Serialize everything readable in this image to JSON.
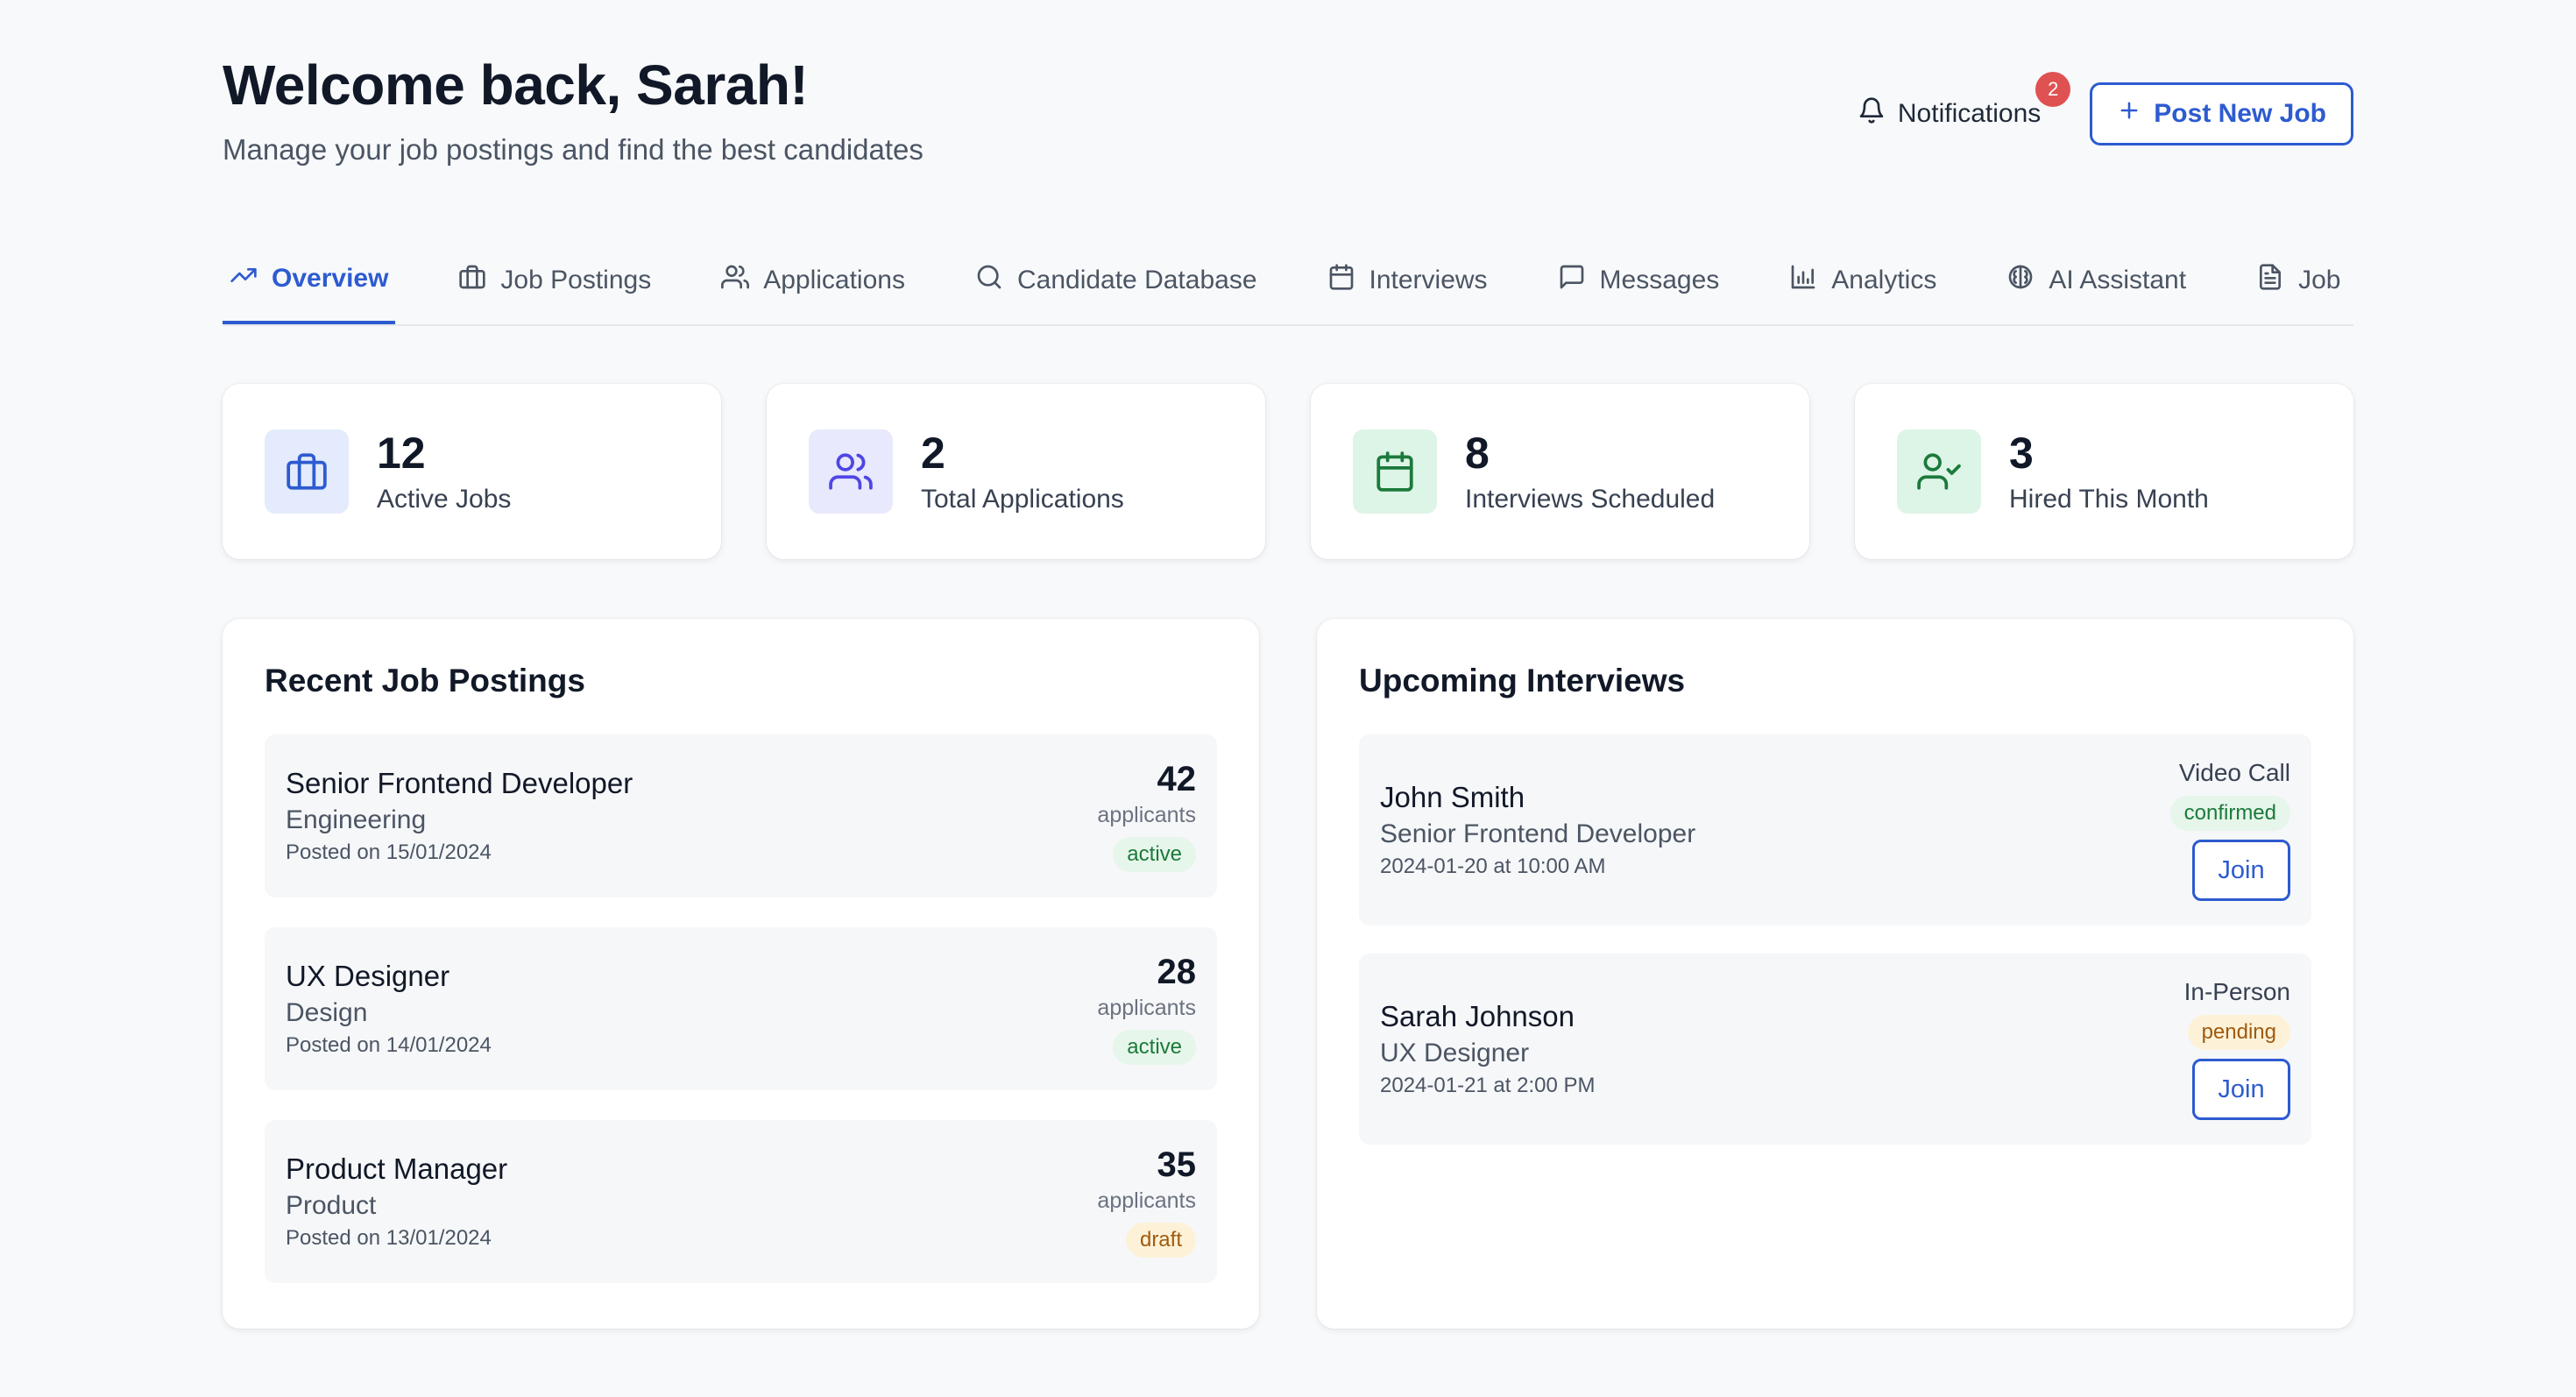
{
  "header": {
    "title": "Welcome back, Sarah!",
    "subtitle": "Manage your job postings and find the best candidates",
    "notifications_label": "Notifications",
    "notifications_count": "2",
    "post_job_label": "Post New Job"
  },
  "tabs": [
    {
      "label": "Overview",
      "icon": "trending-up-icon",
      "active": true
    },
    {
      "label": "Job Postings",
      "icon": "briefcase-icon"
    },
    {
      "label": "Applications",
      "icon": "users-icon"
    },
    {
      "label": "Candidate Database",
      "icon": "search-icon"
    },
    {
      "label": "Interviews",
      "icon": "calendar-icon"
    },
    {
      "label": "Messages",
      "icon": "message-icon"
    },
    {
      "label": "Analytics",
      "icon": "bar-chart-icon"
    },
    {
      "label": "AI Assistant",
      "icon": "brain-icon"
    },
    {
      "label": "Job",
      "icon": "document-icon"
    }
  ],
  "stats": [
    {
      "value": "12",
      "label": "Active Jobs",
      "icon": "briefcase-icon",
      "color": "#2d5bd0",
      "bg": "#e3ebfc"
    },
    {
      "value": "2",
      "label": "Total Applications",
      "icon": "users-icon",
      "color": "#4f46e5",
      "bg": "#e8e9fc"
    },
    {
      "value": "8",
      "label": "Interviews Scheduled",
      "icon": "calendar-icon",
      "color": "#1b7a3b",
      "bg": "#ddf5e6"
    },
    {
      "value": "3",
      "label": "Hired This Month",
      "icon": "user-check-icon",
      "color": "#1b7a3b",
      "bg": "#ddf5e6"
    }
  ],
  "recent_jobs": {
    "title": "Recent Job Postings",
    "items": [
      {
        "title": "Senior Frontend Developer",
        "department": "Engineering",
        "posted": "Posted on 15/01/2024",
        "count": "42",
        "applicants_label": "applicants",
        "status": "active"
      },
      {
        "title": "UX Designer",
        "department": "Design",
        "posted": "Posted on 14/01/2024",
        "count": "28",
        "applicants_label": "applicants",
        "status": "active"
      },
      {
        "title": "Product Manager",
        "department": "Product",
        "posted": "Posted on 13/01/2024",
        "count": "35",
        "applicants_label": "applicants",
        "status": "draft"
      }
    ]
  },
  "interviews": {
    "title": "Upcoming Interviews",
    "items": [
      {
        "name": "John Smith",
        "role": "Senior Frontend Developer",
        "time": "2024-01-20 at 10:00 AM",
        "type": "Video Call",
        "status": "confirmed",
        "join_label": "Join"
      },
      {
        "name": "Sarah Johnson",
        "role": "UX Designer",
        "time": "2024-01-21 at 2:00 PM",
        "type": "In-Person",
        "status": "pending",
        "join_label": "Join"
      }
    ]
  },
  "colors": {
    "accent": "#2d5bd0",
    "background": "#f8f9fb",
    "badge_red": "#e05252"
  }
}
